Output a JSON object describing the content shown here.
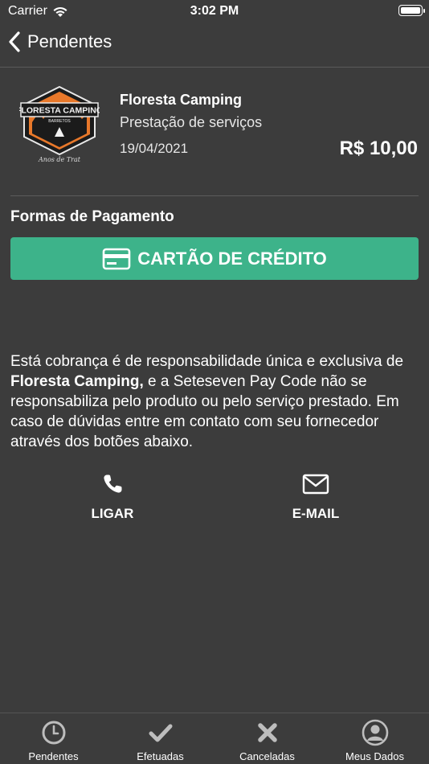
{
  "status_bar": {
    "carrier": "Carrier",
    "time": "3:02 PM"
  },
  "nav": {
    "back_label": "Pendentes"
  },
  "merchant": {
    "logo_text": "FLORESTA CAMPING",
    "logo_subtext": "BARRETOS",
    "logo_script": "Anos de Trat",
    "name": "Floresta Camping",
    "description": "Prestação de serviços",
    "date": "19/04/2021",
    "amount": "R$ 10,00"
  },
  "payment": {
    "section_title": "Formas de Pagamento",
    "credit_card_label": "CARTÃO DE CRÉDITO"
  },
  "disclaimer": {
    "part1": "Está cobrança é de responsabilidade única e exclusiva de ",
    "merchant_bold": "Floresta Camping,",
    "part2": " e a Seteseven Pay Code não se responsabiliza pelo produto ou pelo serviço prestado. Em caso de dúvidas entre em contato com seu fornecedor através dos botões abaixo."
  },
  "contact": {
    "call_label": "LIGAR",
    "email_label": "E-MAIL"
  },
  "tabs": [
    {
      "label": "Pendentes",
      "icon": "clock-icon"
    },
    {
      "label": "Efetuadas",
      "icon": "check-icon"
    },
    {
      "label": "Canceladas",
      "icon": "x-icon"
    },
    {
      "label": "Meus Dados",
      "icon": "user-icon"
    }
  ],
  "colors": {
    "background": "#3c3c3c",
    "accent": "#3db38a"
  }
}
